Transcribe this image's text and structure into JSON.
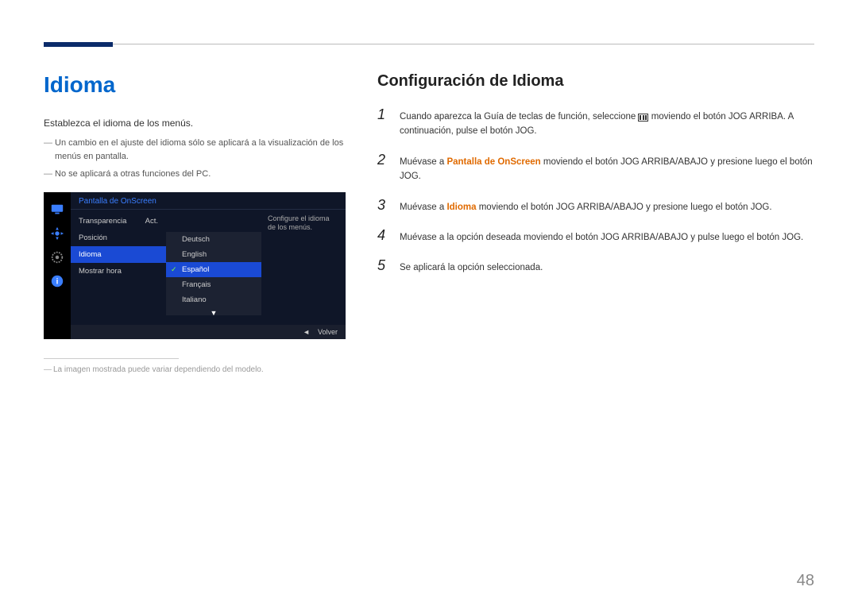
{
  "page": {
    "number": "48",
    "title": "Idioma",
    "intro": "Establezca el idioma de los menús.",
    "note1": "Un cambio en el ajuste del idioma sólo se aplicará a la visualización de los menús en pantalla.",
    "note2": "No se aplicará a otras funciones del PC.",
    "footnote": "La imagen mostrada puede variar dependiendo del modelo."
  },
  "osd": {
    "header": "Pantalla de OnScreen",
    "menu": {
      "transparencia": "Transparencia",
      "transparencia_val": "Act.",
      "posicion": "Posición",
      "idioma": "Idioma",
      "mostrar_hora": "Mostrar hora"
    },
    "languages": {
      "deutsch": "Deutsch",
      "english": "English",
      "espanol": "Español",
      "francais": "Français",
      "italiano": "Italiano"
    },
    "help": "Configure el idioma de los menús.",
    "footer_back": "Volver"
  },
  "right": {
    "heading": "Configuración de Idioma",
    "step1_a": "Cuando aparezca la Guía de teclas de función, seleccione ",
    "step1_b": " moviendo el botón JOG ARRIBA. A continuación, pulse el botón JOG.",
    "step2_a": "Muévase a ",
    "step2_hl": "Pantalla de OnScreen",
    "step2_b": " moviendo el botón JOG ARRIBA/ABAJO y presione luego el botón JOG.",
    "step3_a": "Muévase a ",
    "step3_hl": "Idioma",
    "step3_b": " moviendo el botón JOG ARRIBA/ABAJO y presione luego el botón JOG.",
    "step4": "Muévase a la opción deseada moviendo el botón JOG ARRIBA/ABAJO y pulse luego el botón JOG.",
    "step5": "Se aplicará la opción seleccionada."
  }
}
